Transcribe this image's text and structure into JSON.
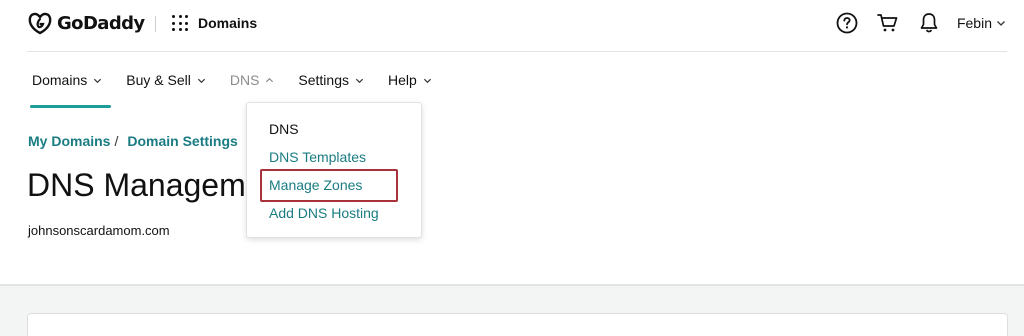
{
  "header": {
    "brand": "GoDaddy",
    "app_label": "Domains",
    "user_name": "Febin"
  },
  "nav": {
    "items": [
      {
        "label": "Domains",
        "state": "active"
      },
      {
        "label": "Buy & Sell",
        "state": "default"
      },
      {
        "label": "DNS",
        "state": "open"
      },
      {
        "label": "Settings",
        "state": "default"
      },
      {
        "label": "Help",
        "state": "default"
      }
    ]
  },
  "dns_menu": {
    "items": [
      {
        "label": "DNS",
        "kind": "heading"
      },
      {
        "label": "DNS Templates",
        "kind": "link"
      },
      {
        "label": "Manage Zones",
        "kind": "link",
        "highlighted": true
      },
      {
        "label": "Add DNS Hosting",
        "kind": "link"
      }
    ]
  },
  "breadcrumb": {
    "items": [
      "My Domains",
      "Domain Settings"
    ],
    "separator": "/"
  },
  "page": {
    "title": "DNS Management",
    "domain": "johnsonscardamom.com"
  },
  "colors": {
    "accent": "#1c9c9a",
    "link": "#1a7c82",
    "highlight": "#a8323a"
  },
  "icons": {
    "help": "help-circle-icon",
    "cart": "cart-icon",
    "notifications": "bell-icon",
    "apps": "apps-grid-icon"
  }
}
